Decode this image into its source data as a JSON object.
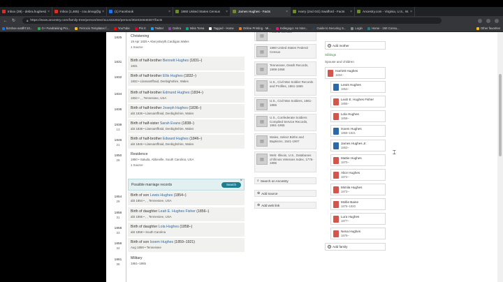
{
  "tabs": [
    {
      "title": "Inbox (39) - debra.hughes@ma...",
      "color": "#d93025"
    },
    {
      "title": "Inbox (1,465) - cou.timog@gma...",
      "color": "#d93025"
    },
    {
      "title": "(1) Facebook",
      "color": "#1877f2"
    },
    {
      "title": "1950 United States Census",
      "color": "#6b8e23"
    },
    {
      "title": "James Hughes - Facts",
      "color": "#6b8e23"
    },
    {
      "title": "Harry (2nd GG) Swafford - Facts",
      "color": "#6b8e23"
    },
    {
      "title": "Ancestry.com - Virginia, U.S., W...",
      "color": "#6b8e23"
    }
  ],
  "address": {
    "url": "https://www.ancestry.com/family-tree/person/tree/111432282/person/302034848307/facts"
  },
  "bookmarks": [
    {
      "label": "bizshoe.sutdfrt:10...",
      "color": "#1a73e8"
    },
    {
      "label": "G+ Fundraising Pro...",
      "color": "#34a853"
    },
    {
      "label": "Ferrocio Templates f...",
      "color": "#fbbc04"
    },
    {
      "label": "YouTube",
      "color": "#ff0000"
    },
    {
      "label": "Pin It",
      "color": "#e60023"
    },
    {
      "label": "Twitter",
      "color": "#1da1f2"
    },
    {
      "label": "Dahra",
      "color": "#8e44ad"
    },
    {
      "label": "Miss Toma",
      "color": "#16a085"
    },
    {
      "label": "Tagged - Home",
      "color": "#ffffff"
    },
    {
      "label": "Online Printing - Mi...",
      "color": "#e67e22"
    },
    {
      "label": "Indiegogo: An Inter...",
      "color": "#eb1478"
    },
    {
      "label": "Guide to Securing S...",
      "color": "#2c3e50"
    },
    {
      "label": "Login",
      "color": "#7f8c8d"
    },
    {
      "label": "Home - 150 Consu...",
      "color": "#1e7d91"
    }
  ],
  "other_bookmarks": "Other favorites",
  "timeline": [
    {
      "year": "1825",
      "age": "",
      "title_prefix": "Christening",
      "title_link": "",
      "title_suffix": "",
      "detail": "19 Apr 1825 • Aberystwyth,Cardigan,Wales",
      "source": "1 Source",
      "white": true
    },
    {
      "year": "1831",
      "age": "",
      "title_prefix": "Birth of half-brother ",
      "title_link": "Bennett Hughes",
      "title_suffix": " (1831–)",
      "detail": "1831",
      "source": "",
      "white": false
    },
    {
      "year": "1832",
      "age": "",
      "title_prefix": "Birth of half-brother ",
      "title_link": "Ellis Hughes",
      "title_suffix": " (1832–)",
      "detail": "1832 • Llansantffraid, Denbighshire, Wales",
      "source": "",
      "white": false
    },
    {
      "year": "1834",
      "age": "",
      "title_prefix": "Birth of half-brother ",
      "title_link": "Edmund Hughes",
      "title_suffix": " (1834–)",
      "detail": "1834 • , , Tennessee, USA",
      "source": "",
      "white": false
    },
    {
      "year": "1836",
      "age": "",
      "title_prefix": "Birth of half-brother ",
      "title_link": "Joseph Hughes",
      "title_suffix": " (1836–)",
      "detail": "abt 1836 • Llansantffraid, Denbighshire, Wales",
      "source": "",
      "white": false
    },
    {
      "year": "1838",
      "age": "13",
      "title_prefix": "Birth of half-sister ",
      "title_link": "Sarah Evans",
      "title_suffix": " (1838–)",
      "detail": "abt 1838 • Llansantffraid, Denbighshire, Wales",
      "source": "",
      "white": false
    },
    {
      "year": "1846",
      "age": "21",
      "title_prefix": "Birth of half-brother ",
      "title_link": "Edward Hughes",
      "title_suffix": " (1846–)",
      "detail": "abt 1846 • Llansantffraid, Denbighshire, Wales",
      "source": "",
      "white": false
    },
    {
      "year": "1850",
      "age": "25",
      "title_prefix": "Residence",
      "title_link": "",
      "title_suffix": "",
      "detail": "1850 • Saluda, Abbeville, South Carolina, USA",
      "source": "1 Source",
      "white": true
    },
    {
      "year": "1854",
      "age": "29",
      "title_prefix": "Birth of son ",
      "title_link": "Lewis Hughes",
      "title_suffix": " (1854–)",
      "detail": "abt 1854 • , , Tennessee, USA",
      "source": "",
      "white": false
    },
    {
      "year": "1856",
      "age": "31",
      "title_prefix": "Birth of daughter ",
      "title_link": "Leah E. Hughes Fisher",
      "title_suffix": " (1856–)",
      "detail": "abt 1856 • , , Tennessee, USA",
      "source": "",
      "white": false
    },
    {
      "year": "1858",
      "age": "33",
      "title_prefix": "Birth of daughter ",
      "title_link": "Lola Hughes",
      "title_suffix": " (1858–)",
      "detail": "abt 1858 • South Carolina",
      "source": "",
      "white": false
    },
    {
      "year": "1859",
      "age": "34",
      "title_prefix": "Birth of son ",
      "title_link": "Isoem Hughes",
      "title_suffix": " (1859–1921)",
      "detail": "Aug 1859 • Tennessee",
      "source": "",
      "white": false
    },
    {
      "year": "1861",
      "age": "36",
      "title_prefix": "Military",
      "title_link": "",
      "title_suffix": "",
      "detail": "1861–1865",
      "source": "",
      "white": true
    }
  ],
  "possible_marriage": {
    "label": "Possible marriage records",
    "button": "Search",
    "close": "×"
  },
  "sources": [
    {
      "text": "Federal Census"
    },
    {
      "text": "1880 United States Federal Census"
    },
    {
      "text": "Tennessee, Death Records, 1908-1958"
    },
    {
      "text": "U.S., Civil War Soldier Records and Profiles, 1861-1865"
    },
    {
      "text": "U.S., Civil War Soldiers, 1861-1865"
    },
    {
      "text": "U.S., Confederate Soldiers Compiled Service Records, 1861-1865"
    },
    {
      "text": "Wales, Select Births and Baptisms, 1541-1907"
    },
    {
      "text": "Web: Illinois, U.S., Databases of Illinois Veterans Index, 1775-1995"
    }
  ],
  "source_actions": {
    "search": "Search on Ancestry",
    "add_source": "Add source",
    "add_web_link": "Add web link"
  },
  "family": {
    "add_mother": "Add mother",
    "siblings_label": "Siblings",
    "spouse_label": "Spouse and children",
    "spouse": {
      "name": "Harriett Hughes",
      "years": "1834–",
      "sex": "f"
    },
    "children": [
      {
        "name": "Lewis Hughes",
        "years": "1854–",
        "sex": "m"
      },
      {
        "name": "Leah E. Hughes Fisher",
        "years": "1856–",
        "sex": "f"
      },
      {
        "name": "Lola Hughes",
        "years": "1858–",
        "sex": "f"
      },
      {
        "name": "Isoem Hughes",
        "years": "1859–1921",
        "sex": "m"
      },
      {
        "name": "James Hughes Jr.",
        "years": "1863–",
        "sex": "m"
      },
      {
        "name": "Mattie Hughes",
        "years": "1870–",
        "sex": "f"
      },
      {
        "name": "Alice Hughes",
        "years": "1872–",
        "sex": "f"
      },
      {
        "name": "Mimila Hughes",
        "years": "1873–",
        "sex": "f"
      },
      {
        "name": "Mollie Baine",
        "years": "1876–1920",
        "sex": "f"
      },
      {
        "name": "Lura Hughes",
        "years": "1877–",
        "sex": "f"
      },
      {
        "name": "Nena Hughes",
        "years": "1879–",
        "sex": "f"
      }
    ],
    "add_family": "Add family"
  }
}
